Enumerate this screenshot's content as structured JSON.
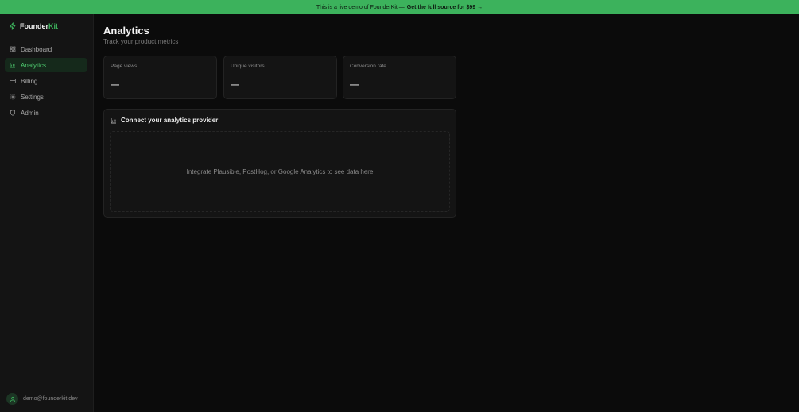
{
  "banner": {
    "text": "This is a live demo of FounderKit —",
    "link": "Get the full source for $99 →"
  },
  "brand": {
    "name_part1": "Founder",
    "name_part2": "Kit",
    "icon": "zap-icon"
  },
  "sidebar": {
    "items": [
      {
        "label": "Dashboard",
        "icon": "grid-icon",
        "active": false
      },
      {
        "label": "Analytics",
        "icon": "bar-chart-icon",
        "active": true
      },
      {
        "label": "Billing",
        "icon": "credit-card-icon",
        "active": false
      },
      {
        "label": "Settings",
        "icon": "gear-icon",
        "active": false
      },
      {
        "label": "Admin",
        "icon": "shield-icon",
        "active": false
      }
    ]
  },
  "user": {
    "email": "demo@founderkit.dev",
    "icon": "user-icon"
  },
  "page": {
    "title": "Analytics",
    "subtitle": "Track your product metrics"
  },
  "metrics": [
    {
      "label": "Page views",
      "value": "—"
    },
    {
      "label": "Unique visitors",
      "value": "—"
    },
    {
      "label": "Conversion rate",
      "value": "—"
    }
  ],
  "provider": {
    "title": "Connect your analytics provider",
    "message": "Integrate Plausible, PostHog, or Google Analytics to see data here",
    "icon": "bar-chart-icon"
  },
  "colors": {
    "accent": "#3cb25c",
    "background": "#0b0b0b",
    "sidebar": "#141414"
  }
}
